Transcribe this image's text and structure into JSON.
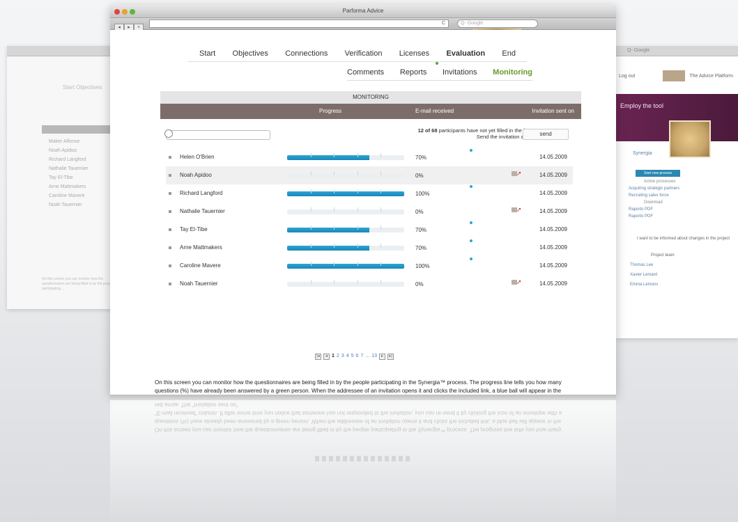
{
  "window": {
    "title": "Parforma Advice",
    "address_glyph": "C",
    "search_placeholder": "Q- Google"
  },
  "nav": {
    "items": [
      "Start",
      "Objectives",
      "Connections",
      "Verification",
      "Licenses",
      "Evaluation",
      "End"
    ],
    "active": "Evaluation"
  },
  "subnav": {
    "items": [
      "Comments",
      "Reports",
      "Invitations",
      "Monitoring"
    ],
    "active": "Monitoring"
  },
  "monitoring": {
    "title": "MONITORING",
    "columns": [
      "Progress",
      "E-mail received",
      "Invitation sent on"
    ],
    "notice_count": "12 of 68",
    "notice_text_1": " participants have not yet filled in the form.",
    "notice_text_2": "Send the invitation again:",
    "send_label": "send",
    "rows": [
      {
        "name": "Helen O'Brien",
        "progress": 70,
        "pct": "70%",
        "email_received": true,
        "resend": false,
        "date": "14.05.2009"
      },
      {
        "name": "Noah Apidoo",
        "progress": 0,
        "pct": "0%",
        "email_received": false,
        "resend": true,
        "date": "14.05.2009"
      },
      {
        "name": "Richard Langford",
        "progress": 100,
        "pct": "100%",
        "email_received": true,
        "resend": false,
        "date": "14.05.2009"
      },
      {
        "name": "Nathalie Tauernier",
        "progress": 0,
        "pct": "0%",
        "email_received": false,
        "resend": true,
        "date": "14.05.2009"
      },
      {
        "name": "Tay El-Tibe",
        "progress": 70,
        "pct": "70%",
        "email_received": true,
        "resend": false,
        "date": "14.05.2009"
      },
      {
        "name": "Arne Mattmakers",
        "progress": 70,
        "pct": "70%",
        "email_received": true,
        "resend": false,
        "date": "14.05.2009"
      },
      {
        "name": "Caroline Mavere",
        "progress": 100,
        "pct": "100%",
        "email_received": true,
        "resend": false,
        "date": "14.05.2009"
      },
      {
        "name": "Noah Tauernier",
        "progress": 0,
        "pct": "0%",
        "email_received": false,
        "resend": true,
        "date": "14.05.2009"
      }
    ],
    "pager": [
      "1",
      "2",
      "3",
      "4",
      "5",
      "6",
      "7",
      "...",
      "13"
    ],
    "pager_current": "1",
    "description": "On this screen you can monitor how the questionnaires are being filled in by the people participating in the Synergia™ process. The progress line tells you how many questions (%) have already been answered by a green person. When the addressee of an invitation opens it and clicks the included link, a blue ball will appear in the \"E-mail received\" column. If after some time you notice that someone has not responded to the invitation, you can re-send it by clicking the icon of an envelope with a red arrow. The \"Invitation sent on\""
  },
  "left_window": {
    "nav": "Start   Objectives",
    "list": [
      "Maker Alfonse",
      "Noah Apidoo",
      "Richard Langford",
      "Nathalie Tauernier",
      "Tay El-Tibe",
      "Arne Mattmakers",
      "Caroline Mavere",
      "Noah Tauernier"
    ],
    "para": "On this screen you can monitor how the questionnaires are being filled in by the people participating..."
  },
  "right_window": {
    "search": "Q- Google",
    "login": "Log out",
    "logo_text": "The Advice Platform",
    "banner": "Employ the tool",
    "tab": "Synergia",
    "button": "Start new process",
    "active_label": "Active processes",
    "links": [
      "Acquiring strategic partners",
      "Recruiting sales force"
    ],
    "download": "Download",
    "files": [
      "Raporto PDF",
      "Raporto PDF"
    ],
    "checkbox": "I want to be informed about changes in the project",
    "team_label": "Project team",
    "members": [
      "Thomas Lee",
      "Xavier Lemard",
      "Emma Lemons"
    ]
  },
  "colors": {
    "accent_blue": "#2aa6d6",
    "header_brown": "#7d6d6a",
    "active_green": "#6a9a2a",
    "arrow_red": "#c0381a",
    "banner_purple": "#6a2452"
  }
}
